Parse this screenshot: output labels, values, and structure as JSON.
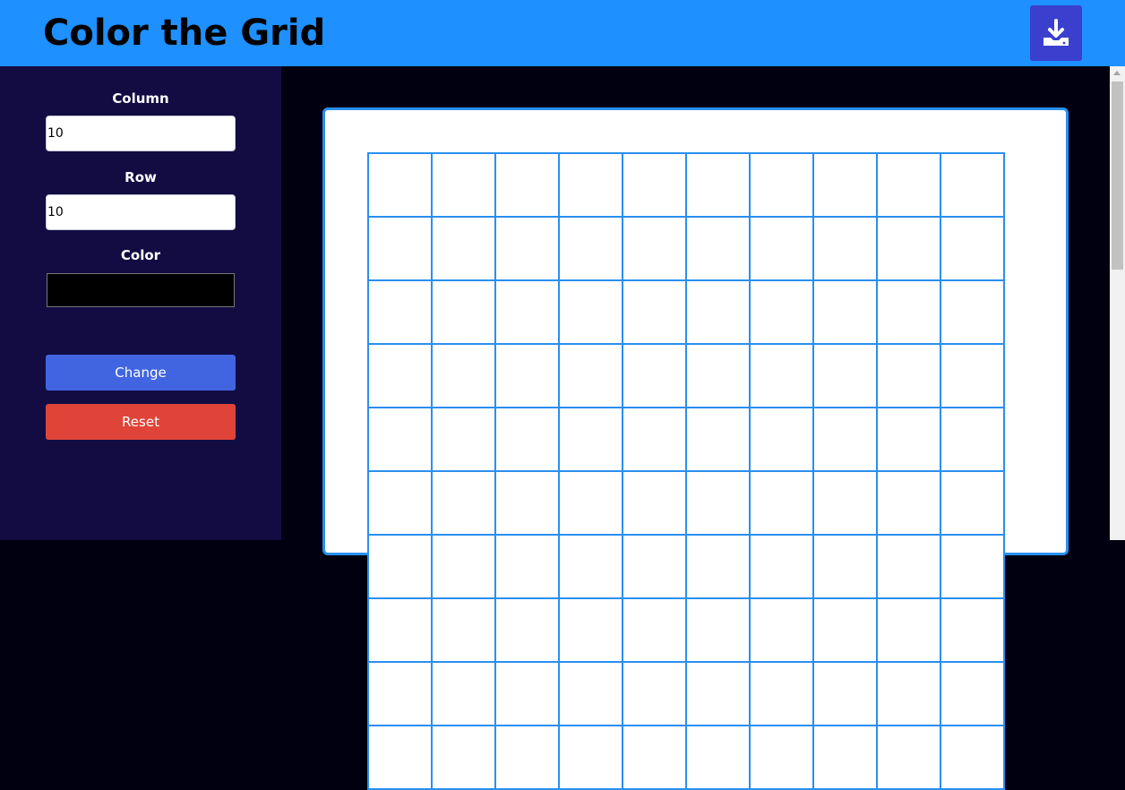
{
  "header": {
    "title": "Color the Grid",
    "download_icon": "download-icon",
    "background": "#1e90ff",
    "button_color": "#3b3fce"
  },
  "sidebar": {
    "column_label": "Column",
    "column_value": "10",
    "row_label": "Row",
    "row_value": "10",
    "color_label": "Color",
    "color_value": "#000000",
    "change_label": "Change",
    "reset_label": "Reset",
    "background": "#120c43",
    "change_color": "#4165e0",
    "reset_color": "#e04438"
  },
  "grid": {
    "columns": 10,
    "rows": 10,
    "line_color": "#2a8ff0",
    "cell_color": "#ffffff"
  }
}
